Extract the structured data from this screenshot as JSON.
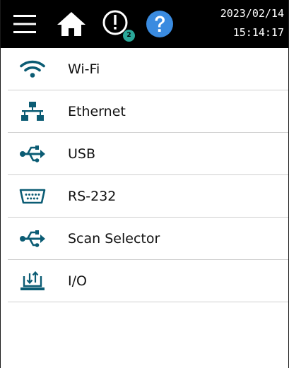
{
  "header": {
    "menu_icon": "hamburger-menu-icon",
    "home_icon": "home-icon",
    "alert_icon": "alert-circle-icon",
    "alert_count": "2",
    "help_icon": "help-question-icon",
    "date": "2023/02/14",
    "time": "15:14:17"
  },
  "menu": {
    "items": [
      {
        "label": "Wi-Fi",
        "icon": "wifi-icon"
      },
      {
        "label": "Ethernet",
        "icon": "ethernet-network-icon"
      },
      {
        "label": "USB",
        "icon": "usb-icon"
      },
      {
        "label": "RS-232",
        "icon": "serial-port-icon"
      },
      {
        "label": "Scan Selector",
        "icon": "usb-icon"
      },
      {
        "label": "I/O",
        "icon": "io-icon"
      }
    ]
  },
  "colors": {
    "header_bg": "#000000",
    "icon_teal": "#0b5c74",
    "help_blue": "#3a8be0",
    "badge_teal": "#2aa89a",
    "divider": "#d0d0d0"
  }
}
